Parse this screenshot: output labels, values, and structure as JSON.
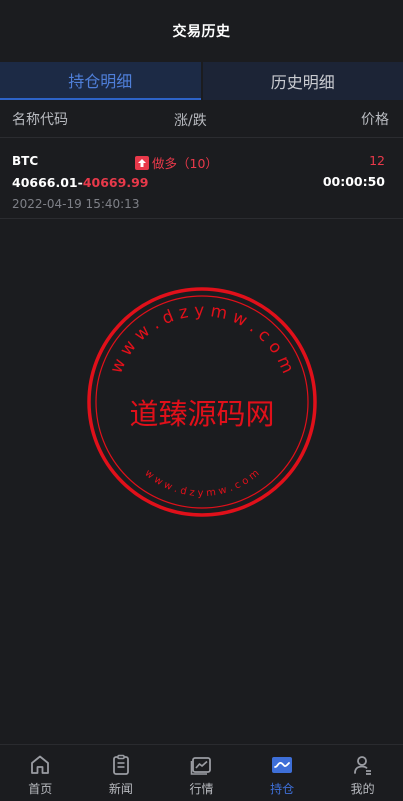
{
  "header": {
    "title": "交易历史"
  },
  "tabs": [
    {
      "label": "持仓明细",
      "active": true
    },
    {
      "label": "历史明细",
      "active": false
    }
  ],
  "columns": {
    "name": "名称代码",
    "change": "涨/跌",
    "price": "价格"
  },
  "position": {
    "symbol": "BTC",
    "direction": "做多（10）",
    "amount": "12",
    "open_price": "40666.01",
    "separator": "-",
    "current_price": "40669.99",
    "countdown": "00:00:50",
    "datetime": "2022-04-19 15:40:13"
  },
  "watermark": {
    "center_text": "道臻源码网",
    "ring_text_top": "w w w . d z y m w . c o m",
    "ring_text_bottom": "w w w . d z y m w . c o m",
    "color": "#e0101a"
  },
  "colors": {
    "background": "#1b1c1f",
    "accent": "#3e6fd8",
    "up": "#e8394a"
  },
  "tabbar": [
    {
      "label": "首页",
      "icon": "home-icon",
      "active": false
    },
    {
      "label": "新闻",
      "icon": "news-icon",
      "active": false
    },
    {
      "label": "行情",
      "icon": "market-icon",
      "active": false
    },
    {
      "label": "持仓",
      "icon": "position-icon",
      "active": true
    },
    {
      "label": "我的",
      "icon": "profile-icon",
      "active": false
    }
  ]
}
